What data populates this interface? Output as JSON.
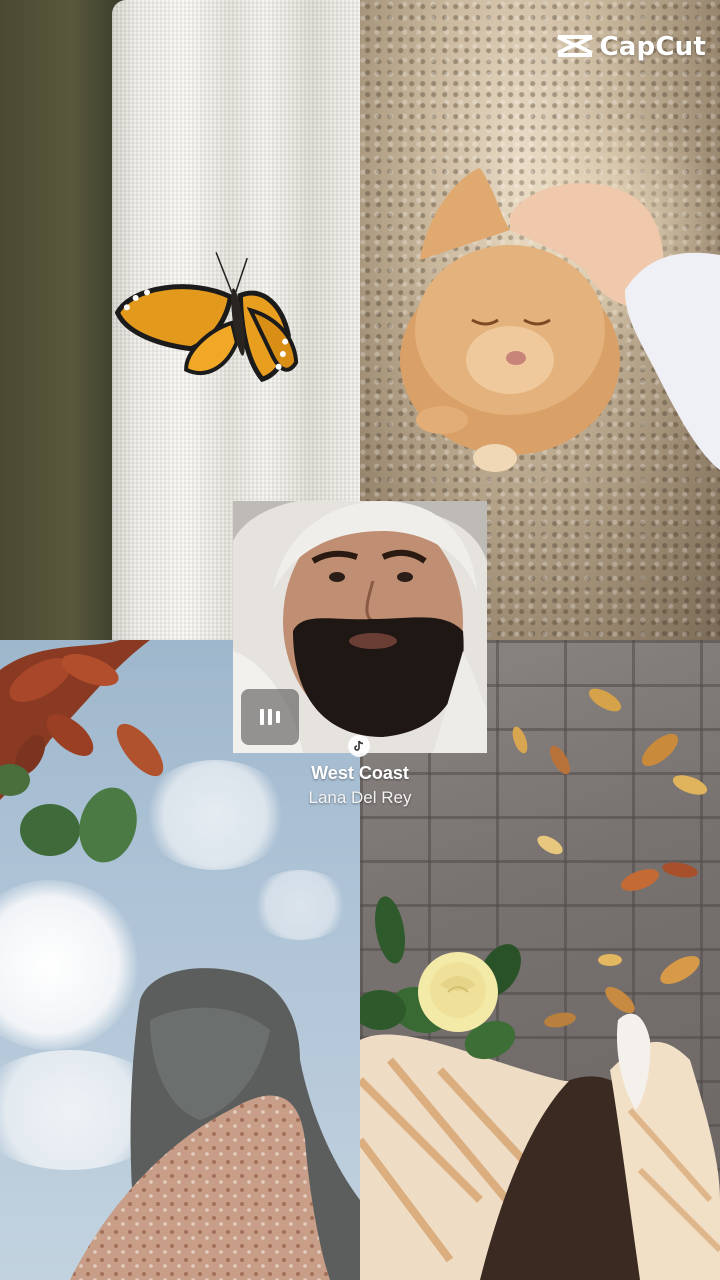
{
  "watermark": {
    "brand": "CapCut",
    "icon": "capcut-logo-icon"
  },
  "video": {
    "control_icon": "pause-icon",
    "badge_icon": "tiktok-icon"
  },
  "music": {
    "title": "West Coast",
    "artist": "Lana Del Rey"
  },
  "colors": {
    "text": "#ffffff",
    "butterfly": "#e39a1c",
    "rose": "#f4eaa8"
  }
}
